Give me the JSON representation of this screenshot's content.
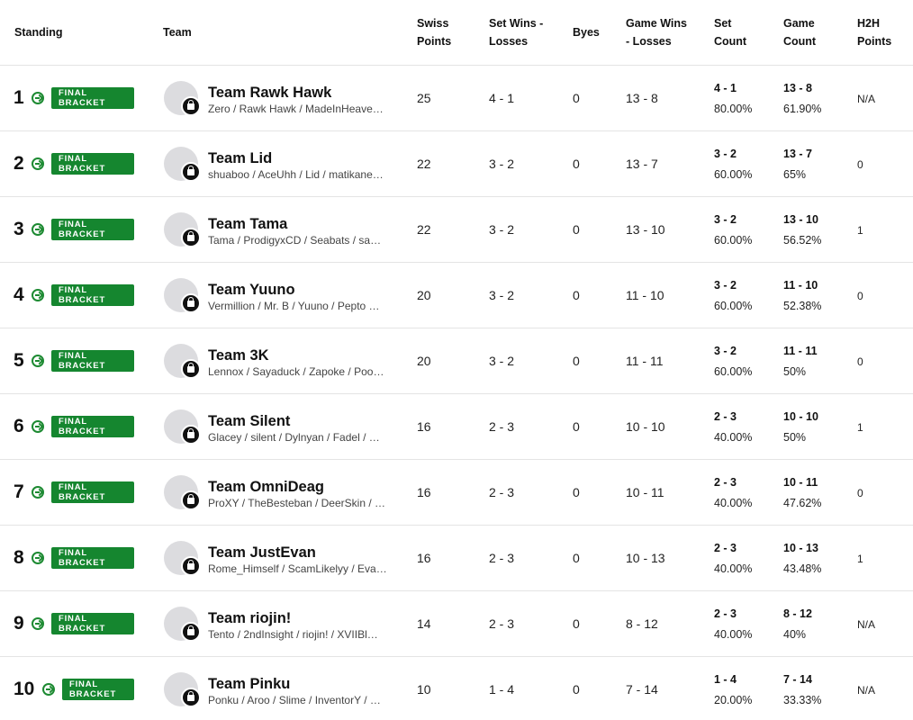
{
  "headers": {
    "standing": "Standing",
    "team": "Team",
    "swiss_points_1": "Swiss",
    "swiss_points_2": "Points",
    "set_wl_1": "Set Wins -",
    "set_wl_2": "Losses",
    "byes": "Byes",
    "game_wl_1": "Game Wins",
    "game_wl_2": "- Losses",
    "set_count_1": "Set",
    "set_count_2": "Count",
    "game_count_1": "Game",
    "game_count_2": "Count",
    "h2h_1": "H2H",
    "h2h_2": "Points"
  },
  "badge": {
    "line1": "FINAL",
    "line2": "BRACKET"
  },
  "rows": [
    {
      "rank": "1",
      "team": "Team Rawk Hawk",
      "players": "Zero / Rawk Hawk / MadeInHeave…",
      "swiss": "25",
      "set_wl": "4 - 1",
      "byes": "0",
      "game_wl": "13 - 8",
      "set_count": "4 - 1",
      "set_pct": "80.00%",
      "game_count": "13 - 8",
      "game_pct": "61.90%",
      "h2h": "N/A"
    },
    {
      "rank": "2",
      "team": "Team Lid",
      "players": "shuaboo / AceUhh / Lid / matikane…",
      "swiss": "22",
      "set_wl": "3 - 2",
      "byes": "0",
      "game_wl": "13 - 7",
      "set_count": "3 - 2",
      "set_pct": "60.00%",
      "game_count": "13 - 7",
      "game_pct": "65%",
      "h2h": "0"
    },
    {
      "rank": "3",
      "team": "Team Tama",
      "players": "Tama / ProdigyxCD / Seabats / sa…",
      "swiss": "22",
      "set_wl": "3 - 2",
      "byes": "0",
      "game_wl": "13 - 10",
      "set_count": "3 - 2",
      "set_pct": "60.00%",
      "game_count": "13 - 10",
      "game_pct": "56.52%",
      "h2h": "1"
    },
    {
      "rank": "4",
      "team": "Team Yuuno",
      "players": "Vermillion / Mr. B / Yuuno / Pepto …",
      "swiss": "20",
      "set_wl": "3 - 2",
      "byes": "0",
      "game_wl": "11 - 10",
      "set_count": "3 - 2",
      "set_pct": "60.00%",
      "game_count": "11 - 10",
      "game_pct": "52.38%",
      "h2h": "0"
    },
    {
      "rank": "5",
      "team": "Team 3K",
      "players": "Lennox / Sayaduck / Zapoke / Poo…",
      "swiss": "20",
      "set_wl": "3 - 2",
      "byes": "0",
      "game_wl": "11 - 11",
      "set_count": "3 - 2",
      "set_pct": "60.00%",
      "game_count": "11 - 11",
      "game_pct": "50%",
      "h2h": "0"
    },
    {
      "rank": "6",
      "team": "Team Silent",
      "players": "Glacey / silent / Dylnyan / Fadel / …",
      "swiss": "16",
      "set_wl": "2 - 3",
      "byes": "0",
      "game_wl": "10 - 10",
      "set_count": "2 - 3",
      "set_pct": "40.00%",
      "game_count": "10 - 10",
      "game_pct": "50%",
      "h2h": "1"
    },
    {
      "rank": "7",
      "team": "Team OmniDeag",
      "players": "ProXY / TheBesteban / DeerSkin / …",
      "swiss": "16",
      "set_wl": "2 - 3",
      "byes": "0",
      "game_wl": "10 - 11",
      "set_count": "2 - 3",
      "set_pct": "40.00%",
      "game_count": "10 - 11",
      "game_pct": "47.62%",
      "h2h": "0"
    },
    {
      "rank": "8",
      "team": "Team JustEvan",
      "players": "Rome_Himself / ScamLikelyy / Eva…",
      "swiss": "16",
      "set_wl": "2 - 3",
      "byes": "0",
      "game_wl": "10 - 13",
      "set_count": "2 - 3",
      "set_pct": "40.00%",
      "game_count": "10 - 13",
      "game_pct": "43.48%",
      "h2h": "1"
    },
    {
      "rank": "9",
      "team": "Team riojin!",
      "players": "Tento / 2ndInsight / riojin! / XVIIBl…",
      "swiss": "14",
      "set_wl": "2 - 3",
      "byes": "0",
      "game_wl": "8 - 12",
      "set_count": "2 - 3",
      "set_pct": "40.00%",
      "game_count": "8 - 12",
      "game_pct": "40%",
      "h2h": "N/A"
    },
    {
      "rank": "10",
      "team": "Team Pinku",
      "players": "Ponku / Aroo / Slime / InventorY / …",
      "swiss": "10",
      "set_wl": "1 - 4",
      "byes": "0",
      "game_wl": "7 - 14",
      "set_count": "1 - 4",
      "set_pct": "20.00%",
      "game_count": "7 - 14",
      "game_pct": "33.33%",
      "h2h": "N/A"
    }
  ]
}
